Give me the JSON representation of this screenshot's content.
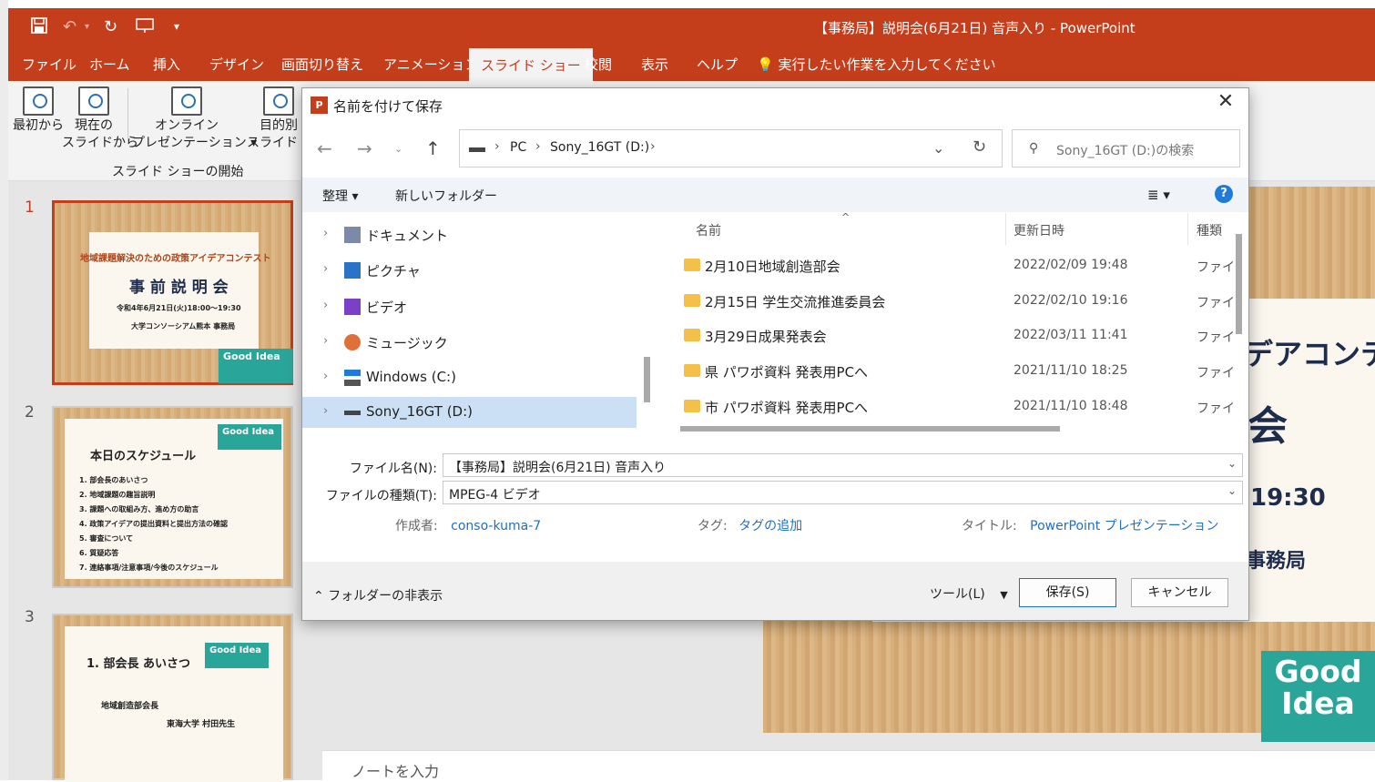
{
  "window": {
    "title": "【事務局】説明会(6月21日) 音声入り  -  PowerPoint"
  },
  "qat": {
    "save_icon": "save-icon",
    "undo_icon": "undo-icon",
    "redo_icon": "redo-icon",
    "present_icon": "present-icon",
    "more": "▾"
  },
  "menu": {
    "items": [
      "ファイル",
      "ホーム",
      "挿入",
      "デザイン",
      "画面切り替え",
      "アニメーション",
      "スライド ショー",
      "校閲",
      "表示",
      "ヘルプ"
    ],
    "active": "スライド ショー",
    "tellme": "実行したい作業を入力してください"
  },
  "ribbon": {
    "buttons": [
      {
        "line1": "最初から",
        "line2": ""
      },
      {
        "line1": "現在の",
        "line2": "スライドから"
      },
      {
        "line1": "オンライン",
        "line2": "プレゼンテーション ▾"
      },
      {
        "line1": "目的別",
        "line2": "スライド ショ"
      }
    ],
    "group_label": "スライド ショーの開始"
  },
  "slides": [
    {
      "num": "1",
      "subtitle": "地域課題解決のための政策アイデアコンテスト",
      "title": "事 前 説 明 会",
      "date": "令和4年6月21日(火)18:00～19:30",
      "org": "大学コンソーシアム熊本  事務局",
      "badge": "Good Idea"
    },
    {
      "num": "2",
      "title": "本日のスケジュール",
      "badge": "Good Idea",
      "items": [
        "1. 部会長のあいさつ",
        "2. 地域課題の趣旨説明",
        "3. 課題への取組み方、進め方の助言",
        "4. 政策アイデアの提出資料と提出方法の確認",
        "5. 審査について",
        "6. 質疑応答",
        "7. 連絡事項/注意事項/今後のスケジュール"
      ]
    },
    {
      "num": "3",
      "title": "1. 部会長  あいさつ",
      "line1": "地域創造部会長",
      "line2": "東海大学    村田先生",
      "badge": "Good Idea"
    }
  ],
  "main_slide": {
    "text1": "デアコンテス",
    "text2": "会",
    "text3": "19:30",
    "text4": "事務局",
    "badge1": "Good",
    "badge2": "Idea"
  },
  "notes": {
    "placeholder": "ノートを入力"
  },
  "dialog": {
    "title": "名前を付けて保存",
    "close": "✕",
    "breadcrumb": [
      "PC",
      "Sony_16GT (D:)"
    ],
    "search_placeholder": "Sony_16GT (D:)の検索",
    "toolbar": {
      "organize": "整理 ▾",
      "new_folder": "新しいフォルダー",
      "view": "≣ ▾",
      "help": "?"
    },
    "nav_items": [
      {
        "label": "ドキュメント",
        "icon": "documents-icon"
      },
      {
        "label": "ピクチャ",
        "icon": "pictures-icon"
      },
      {
        "label": "ビデオ",
        "icon": "videos-icon"
      },
      {
        "label": "ミュージック",
        "icon": "music-icon"
      },
      {
        "label": "Windows (C:)",
        "icon": "drive-icon"
      },
      {
        "label": "Sony_16GT (D:)",
        "icon": "usb-drive-icon",
        "selected": true
      }
    ],
    "columns": {
      "name": "名前",
      "modified": "更新日時",
      "type": "種類"
    },
    "files": [
      {
        "name": "2月10日地域創造部会",
        "modified": "2022/02/09 19:48",
        "type": "ファイル"
      },
      {
        "name": "2月15日 学生交流推進委員会",
        "modified": "2022/02/10 19:16",
        "type": "ファイル"
      },
      {
        "name": "3月29日成果発表会",
        "modified": "2022/03/11 11:41",
        "type": "ファイル"
      },
      {
        "name": "県 パワポ資料 発表用PCへ",
        "modified": "2021/11/10 18:25",
        "type": "ファイル"
      },
      {
        "name": "市 パワポ資料 発表用PCへ",
        "modified": "2021/11/10 18:48",
        "type": "ファイル"
      }
    ],
    "filename_label": "ファイル名(N):",
    "filename_value": "【事務局】説明会(6月21日) 音声入り",
    "filetype_label": "ファイルの種類(T):",
    "filetype_value": "MPEG-4 ビデオ",
    "author_label": "作成者:",
    "author_value": "conso-kuma-7",
    "tags_label": "タグ:",
    "tags_value": "タグの追加",
    "doc_title_label": "タイトル:",
    "doc_title_value": "PowerPoint プレゼンテーション",
    "hide_folders": "フォルダーの非表示",
    "tools": "ツール(L)",
    "save": "保存(S)",
    "cancel": "キャンセル"
  },
  "colors": {
    "accent": "#c43e1c",
    "selection": "#cce0f5",
    "link": "#1f6fc4",
    "badge": "#2aa59a"
  }
}
